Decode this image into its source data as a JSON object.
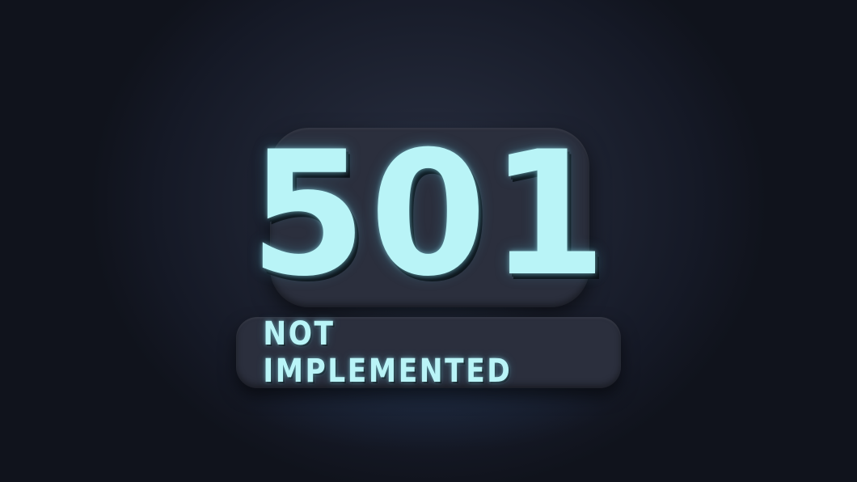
{
  "error": {
    "code": "501",
    "message": "NOT IMPLEMENTED"
  },
  "colors": {
    "background": "#1e2332",
    "plate": "#2b2f3d",
    "glow_text": "#b9f4f7"
  }
}
